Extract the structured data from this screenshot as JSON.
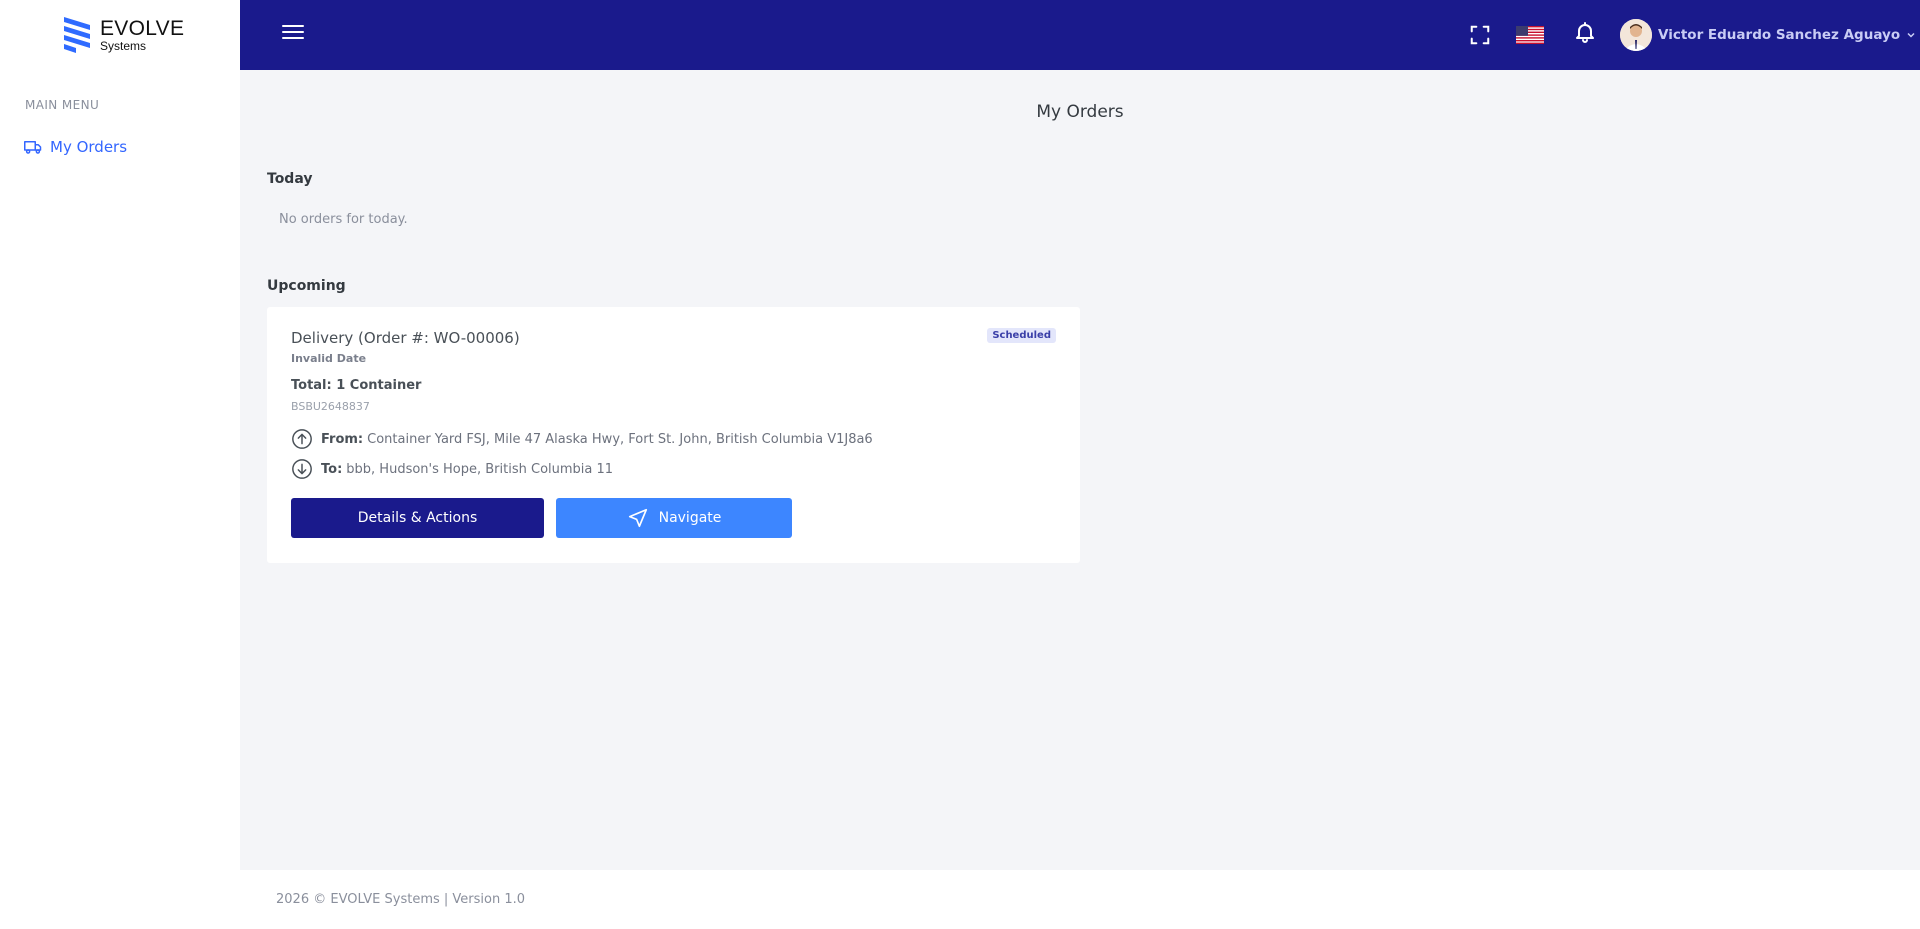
{
  "brand": {
    "name": "EVOLVE",
    "sub": "Systems"
  },
  "sidebar": {
    "menu_title": "MAIN MENU",
    "items": [
      {
        "label": "My Orders",
        "icon": "truck-icon"
      }
    ]
  },
  "header": {
    "user_name": "Victor Eduardo Sanchez Aguayo",
    "accent": "#1a1a8c"
  },
  "main": {
    "page_title": "My Orders",
    "today": {
      "title": "Today",
      "empty": "No orders for today."
    },
    "upcoming": {
      "title": "Upcoming",
      "orders": [
        {
          "title": "Delivery (Order #: WO-00006)",
          "status": "Scheduled",
          "date": "Invalid Date",
          "total": "Total: 1 Container",
          "container": "BSBU2648837",
          "from_label": "From:",
          "from": "Container Yard FSJ, Mile 47 Alaska Hwy, Fort St. John, British Columbia V1J8a6",
          "to_label": "To:",
          "to": "bbb, Hudson's Hope, British Columbia 11",
          "details_label": "Details & Actions",
          "navigate_label": "Navigate"
        }
      ]
    }
  },
  "footer": {
    "text": "2026 © EVOLVE Systems | Version 1.0"
  }
}
